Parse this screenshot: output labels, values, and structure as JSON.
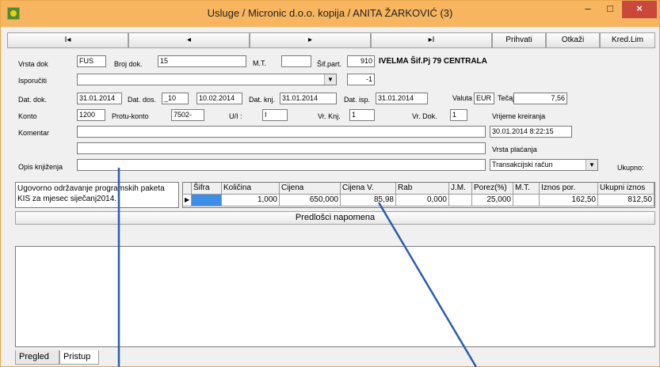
{
  "window": {
    "title": "Usluge / Micronic d.o.o. kopija / ANITA ŽARKOVIĆ (3)",
    "min": "–",
    "max": "□",
    "close": "×"
  },
  "nav": {
    "first": "I◂",
    "prev": "◂",
    "next": "▸",
    "last": "▸I",
    "accept": "Prihvati",
    "cancel": "Otkaži",
    "credit": "Kred.Lim"
  },
  "form": {
    "vrsta_dok_label": "Vrsta dok",
    "vrsta_dok": "FUS",
    "broj_dok_label": "Broj dok.",
    "broj_dok": "15",
    "mt_label": "M.T.",
    "mt": "",
    "sifpart_label": "Šif.part.",
    "sifpart": "910",
    "partner_name": "IVELMA Šif.Pj 79 CENTRALA",
    "isporuciti_label": "Isporučiti",
    "isporuciti": "",
    "isporuciti_code": "-1",
    "datdok_label": "Dat. dok.",
    "datdok": "31.01.2014",
    "datdos_label": "Dat. dos.",
    "datdos1": "_10",
    "datdos2": "10.02.2014",
    "datknj_label": "Dat. knj.",
    "datknj": "31.01.2014",
    "datisp_label": "Dat. isp.",
    "datisp": "31.01.2014",
    "valuta_label": "Valuta",
    "valuta": "EUR",
    "tecaj_label": "Tečaj",
    "tecaj": "7,56",
    "konto_label": "Konto",
    "konto": "1200",
    "protu_label": "Protu-konto",
    "protu": "7502-",
    "ui_label": "U/I :",
    "ui": "I",
    "vrknj_label": "Vr. Knj.",
    "vrknj": "1",
    "vrdok_label": "Vr. Dok.",
    "vrdok": "1",
    "vrijeme_label": "Vrijeme kreiranja",
    "vrijeme": "30.01.2014 8:22:15",
    "komentar_label": "Komentar",
    "komentar": "",
    "komentar2": "",
    "vrsta_placanja_label": "Vrsta plaćanja",
    "vrsta_placanja": "Transakcijski račun",
    "opis_label": "Opis knjiženja",
    "opis": "",
    "ukupno_label": "Ukupno:"
  },
  "memo": "Ugovorno održavanje programskih paketa KIS za mjesec siječanj2014.",
  "grid": {
    "headers": [
      "Šifra",
      "Količina",
      "Cijena",
      "Cijena V.",
      "Rab",
      "J.M.",
      "Porez(%)",
      "M.T.",
      "Iznos por.",
      "Ukupni iznos"
    ],
    "row": [
      "",
      "1,000",
      "650,000",
      "85,98",
      "0,000",
      "",
      "25,000",
      "",
      "162,50",
      "812,50"
    ]
  },
  "predlosci": "Predlošci napomena",
  "tabs": [
    "Pregled",
    "Pristup"
  ],
  "colors": {
    "titlebar": "#f7b55f",
    "annotation": "#2a5db0",
    "close": "#c9473b"
  }
}
